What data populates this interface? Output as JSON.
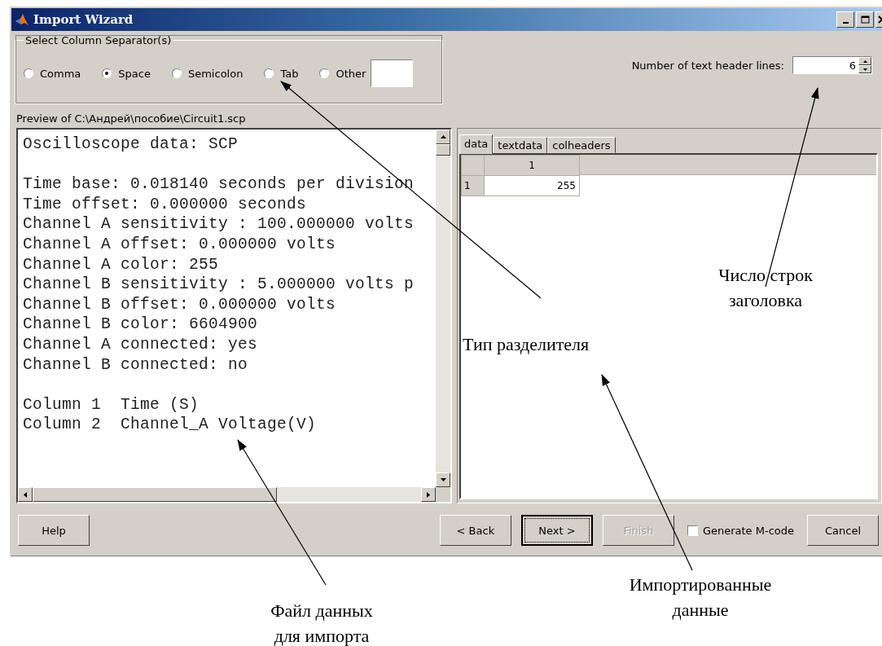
{
  "window": {
    "title": "Import Wizard"
  },
  "separators": {
    "title": "Select Column Separator(s)",
    "options": [
      {
        "label": "Comma",
        "selected": false
      },
      {
        "label": "Space",
        "selected": true
      },
      {
        "label": "Semicolon",
        "selected": false
      },
      {
        "label": "Tab",
        "selected": false
      },
      {
        "label": "Other",
        "selected": false
      }
    ]
  },
  "header_lines": {
    "label": "Number of text header lines:",
    "value": "6"
  },
  "preview": {
    "label": "Preview of C:\\Андрей\\пособие\\Circuit1.scp",
    "paragraphs": [
      [
        "Oscilloscope data: SCP"
      ],
      [
        "Time base: 0.018140 seconds per division",
        "Time offset: 0.000000 seconds",
        "Channel A sensitivity : 100.000000 volts",
        "Channel A offset: 0.000000 volts",
        "Channel A color: 255",
        "Channel B sensitivity : 5.000000 volts p",
        "Channel B offset: 0.000000 volts",
        "Channel B color: 6604900",
        "Channel A connected: yes",
        "Channel B connected: no"
      ],
      [
        "Column 1  Time (S)",
        "Column 2  Channel_A Voltage(V)"
      ]
    ]
  },
  "tabs": [
    {
      "label": "data",
      "selected": true
    },
    {
      "label": "textdata",
      "selected": false
    },
    {
      "label": "colheaders",
      "selected": false
    }
  ],
  "table": {
    "columns": [
      "1"
    ],
    "rows": [
      {
        "header": "1",
        "cells": [
          "255"
        ]
      }
    ]
  },
  "footer": [
    {
      "kind": "button",
      "label": "Help",
      "disabled": false,
      "focused": false
    },
    {
      "kind": "button",
      "label": "< Back",
      "disabled": false,
      "focused": false
    },
    {
      "kind": "button",
      "label": "Next >",
      "disabled": false,
      "focused": true
    },
    {
      "kind": "button",
      "label": "Finish",
      "disabled": true,
      "focused": false
    },
    {
      "kind": "checkbox",
      "label": "Generate M-code",
      "checked": false
    },
    {
      "kind": "button",
      "label": "Cancel",
      "disabled": false,
      "focused": false
    }
  ],
  "annotations": [
    {
      "text": "Тип разделителя"
    },
    {
      "text": "Число строк заголовка"
    },
    {
      "text": "Файл данных для импорта"
    },
    {
      "text": "Импортированные данные"
    }
  ]
}
